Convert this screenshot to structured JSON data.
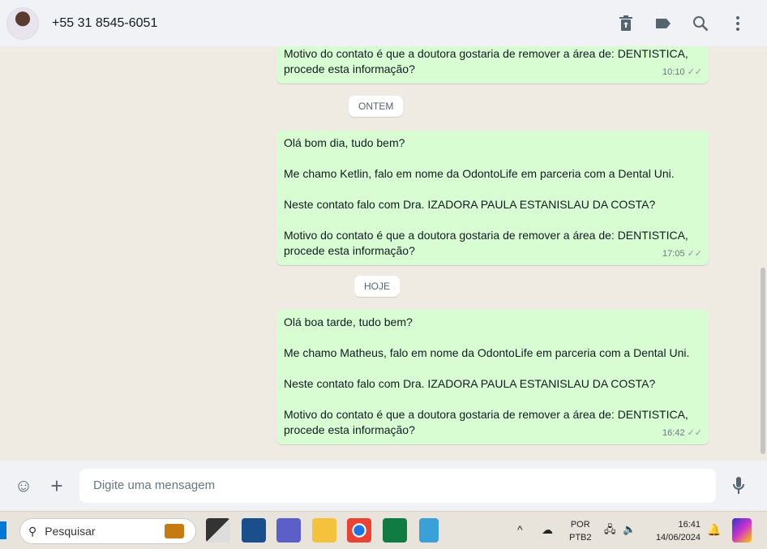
{
  "header": {
    "contact": "+55 31 8545-6051",
    "icons": [
      "archive-icon",
      "label-icon",
      "search-icon",
      "menu-icon"
    ]
  },
  "messages": [
    {
      "lines": [
        "Motivo do contato é que a doutora gostaria de remover a área de: DENTISTICA,",
        "procede esta informação?"
      ],
      "time": "10:10"
    },
    {
      "date": "ONTEM"
    },
    {
      "lines": [
        "Olá bom dia, tudo bem?",
        "",
        "Me chamo Ketlin, falo em nome da OdontoLife em parceria com a Dental Uni.",
        "",
        "Neste contato falo com Dra. IZADORA PAULA ESTANISLAU DA COSTA?",
        "",
        "Motivo do contato é que a doutora gostaria de remover a área de: DENTISTICA,",
        "procede esta informação?"
      ],
      "time": "17:05"
    },
    {
      "date": "HOJE"
    },
    {
      "lines": [
        "Olá boa tarde, tudo bem?",
        "",
        "Me chamo Matheus, falo em nome da OdontoLife em parceria com a Dental Uni.",
        "",
        "Neste contato falo com Dra. IZADORA PAULA ESTANISLAU DA COSTA?",
        "",
        "Motivo do contato é que a doutora gostaria de remover a área de: DENTISTICA,",
        "procede esta informação?"
      ],
      "time": "16:42"
    }
  ],
  "footer": {
    "placeholder": "Digite uma mensagem"
  },
  "taskbar": {
    "search": "Pesquisar",
    "lang1": "POR",
    "lang2": "PTB2",
    "time": "16:41",
    "date": "14/06/2024"
  }
}
